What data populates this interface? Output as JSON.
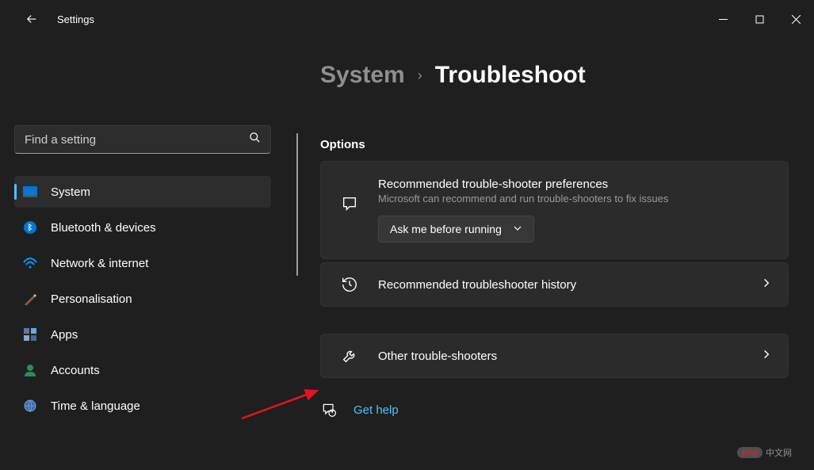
{
  "titlebar": {
    "title": "Settings"
  },
  "search": {
    "placeholder": "Find a setting"
  },
  "nav": {
    "items": [
      {
        "label": "System"
      },
      {
        "label": "Bluetooth & devices"
      },
      {
        "label": "Network & internet"
      },
      {
        "label": "Personalisation"
      },
      {
        "label": "Apps"
      },
      {
        "label": "Accounts"
      },
      {
        "label": "Time & language"
      }
    ]
  },
  "breadcrumb": {
    "parent": "System",
    "separator": "›",
    "current": "Troubleshoot"
  },
  "options": {
    "header": "Options",
    "recommended": {
      "title": "Recommended trouble-shooter preferences",
      "subtitle": "Microsoft can recommend and run trouble-shooters to fix issues",
      "dropdown_value": "Ask me before running"
    },
    "history": {
      "title": "Recommended troubleshooter history"
    },
    "other": {
      "title": "Other trouble-shooters"
    }
  },
  "help": {
    "label": "Get help"
  },
  "watermark": {
    "badge": "php",
    "text": "中文网"
  }
}
